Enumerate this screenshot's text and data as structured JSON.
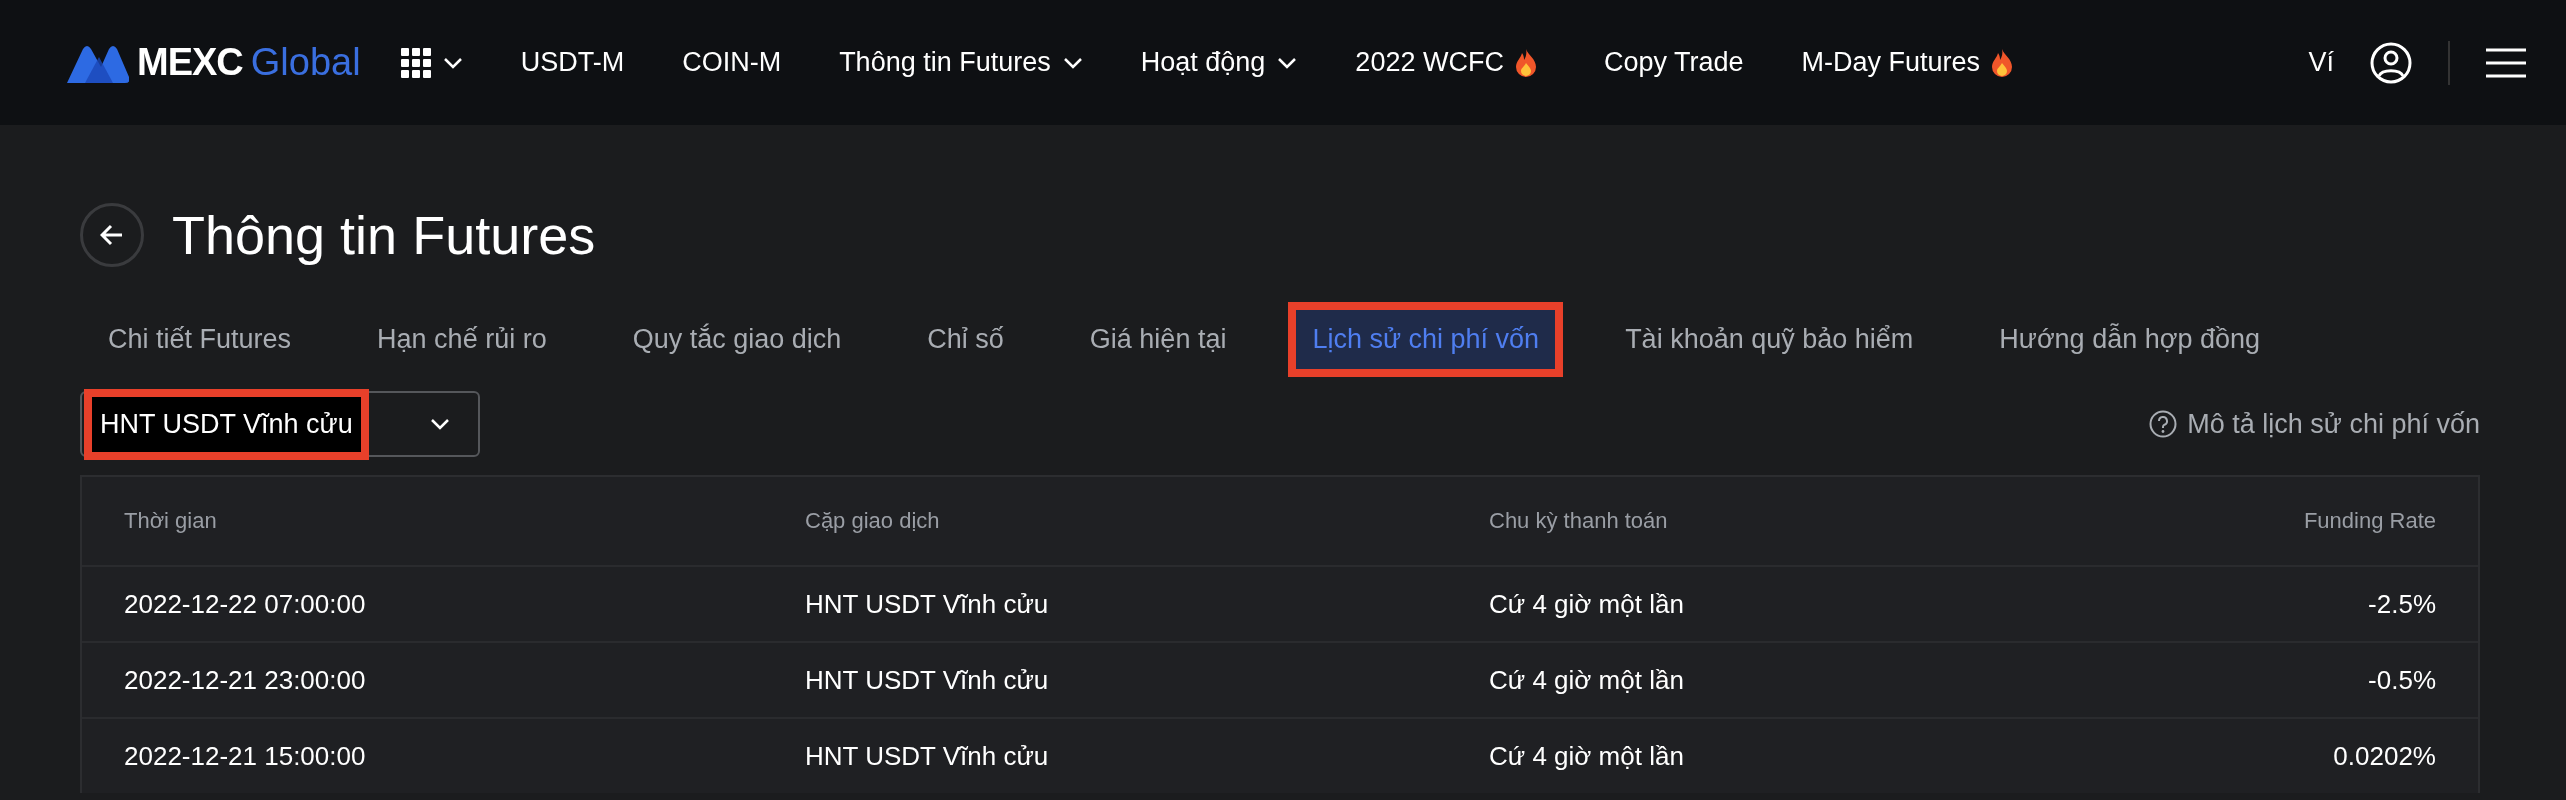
{
  "header": {
    "logo": {
      "brand": "MEXC",
      "suffix": "Global"
    },
    "nav": [
      {
        "label": "USDT-M",
        "has_menu": false,
        "hot": false
      },
      {
        "label": "COIN-M",
        "has_menu": false,
        "hot": false
      },
      {
        "label": "Thông tin Futures",
        "has_menu": true,
        "hot": false
      },
      {
        "label": "Hoạt động",
        "has_menu": true,
        "hot": false
      },
      {
        "label": "2022 WCFC",
        "has_menu": false,
        "hot": true
      },
      {
        "label": "Copy Trade",
        "has_menu": false,
        "hot": false
      },
      {
        "label": "M-Day Futures",
        "has_menu": false,
        "hot": true
      }
    ],
    "wallet": "Ví"
  },
  "page": {
    "title": "Thông tin Futures",
    "tabs": [
      {
        "label": "Chi tiết Futures",
        "selected": false,
        "highlighted": false
      },
      {
        "label": "Hạn chế rủi ro",
        "selected": false,
        "highlighted": false
      },
      {
        "label": "Quy tắc giao dịch",
        "selected": false,
        "highlighted": false
      },
      {
        "label": "Chỉ số",
        "selected": false,
        "highlighted": false
      },
      {
        "label": "Giá hiện tại",
        "selected": false,
        "highlighted": false
      },
      {
        "label": "Lịch sử chi phí vốn",
        "selected": true,
        "highlighted": true
      },
      {
        "label": "Tài khoản quỹ bảo hiểm",
        "selected": false,
        "highlighted": false
      },
      {
        "label": "Hướng dẫn hợp đồng",
        "selected": false,
        "highlighted": false
      }
    ],
    "contract_select": {
      "value": "HNT USDT Vĩnh cửu",
      "highlighted": true
    },
    "help_link": "Mô tả lịch sử chi phí vốn",
    "table": {
      "columns": [
        "Thời gian",
        "Cặp giao dịch",
        "Chu kỳ thanh toán",
        "Funding Rate"
      ],
      "rows": [
        [
          "2022-12-22 07:00:00",
          "HNT USDT Vĩnh cửu",
          "Cứ 4 giờ một lần",
          "-2.5%"
        ],
        [
          "2022-12-21 23:00:00",
          "HNT USDT Vĩnh cửu",
          "Cứ 4 giờ một lần",
          "-0.5%"
        ],
        [
          "2022-12-21 15:00:00",
          "HNT USDT Vĩnh cửu",
          "Cứ 4 giờ một lần",
          "0.0202%"
        ]
      ]
    }
  }
}
